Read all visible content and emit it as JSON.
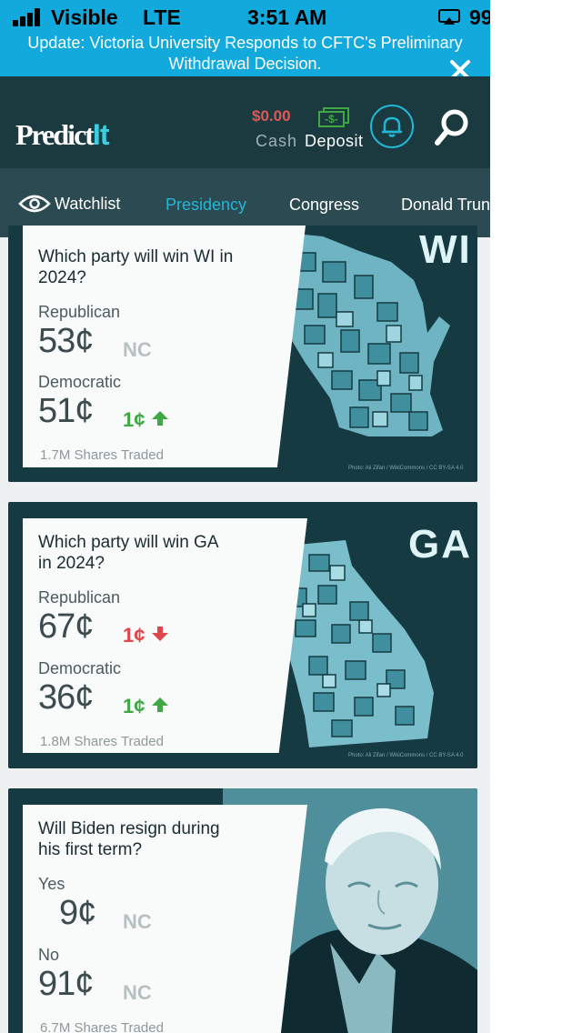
{
  "status_bar": {
    "carrier": "Visible",
    "network": "LTE",
    "time": "3:51 AM",
    "battery": "99%"
  },
  "banner": {
    "text": "Update: Victoria University Responds to CFTC's Preliminary Withdrawal Decision."
  },
  "header": {
    "logo_main": "Predict",
    "logo_accent": "It",
    "cash_amount": "$0.00",
    "cash_label": "Cash",
    "deposit_label": "Deposit"
  },
  "nav": {
    "watchlist": "Watchlist",
    "presidency": "Presidency",
    "congress": "Congress",
    "trump": "Donald Trun"
  },
  "colors": {
    "banner": "#12a9dc",
    "header": "#1b3a40",
    "nav": "#2c4a51",
    "accent": "#21b8d8",
    "up": "#3fa845",
    "down": "#e0474c"
  },
  "markets": [
    {
      "question_line1": "Which party will win WI in",
      "question_line2": "2024?",
      "art_label": "WI",
      "credit": "Photo: Ali Zifan / WikiCommons / CC BY-SA 4.0",
      "options": [
        {
          "label": "Republican",
          "price": "53¢",
          "change": "NC",
          "direction": "none"
        },
        {
          "label": "Democratic",
          "price": "51¢",
          "change": "1¢",
          "direction": "up"
        }
      ],
      "traded": "1.7M Shares Traded"
    },
    {
      "question_line1": "Which party will win GA",
      "question_line2": "in 2024?",
      "art_label": "GA",
      "credit": "Photo: Ali Zifan / WikiCommons / CC BY-SA 4.0",
      "options": [
        {
          "label": "Republican",
          "price": "67¢",
          "change": "1¢",
          "direction": "down"
        },
        {
          "label": "Democratic",
          "price": "36¢",
          "change": "1¢",
          "direction": "up"
        }
      ],
      "traded": "1.8M Shares Traded"
    },
    {
      "question_line1": "Will Biden resign during",
      "question_line2": "his first term?",
      "options": [
        {
          "label": "Yes",
          "price": "9¢",
          "change": "NC",
          "direction": "none"
        },
        {
          "label": "No",
          "price": "91¢",
          "change": "NC",
          "direction": "none"
        }
      ],
      "traded": "6.7M Shares Traded"
    }
  ]
}
